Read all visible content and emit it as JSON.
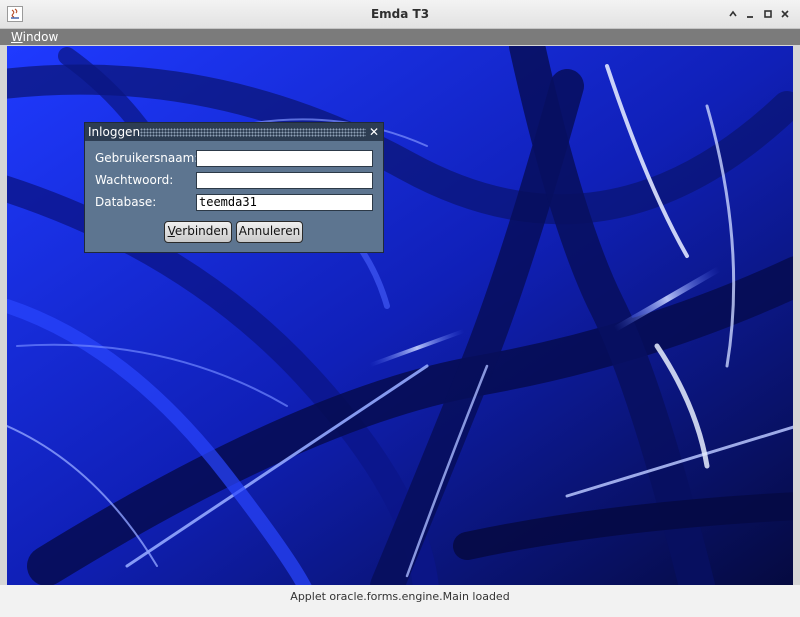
{
  "window": {
    "title": "Emda T3",
    "controls": {
      "minimize": "minimize",
      "maximize": "maximize",
      "close": "close"
    }
  },
  "menubar": {
    "items": [
      {
        "mnemonic": "W",
        "rest": "indow"
      }
    ]
  },
  "dialog": {
    "title": "Inloggen",
    "fields": [
      {
        "label": "Gebruikersnaam:",
        "value": ""
      },
      {
        "label": "Wachtwoord:",
        "value": ""
      },
      {
        "label": "Database:",
        "value": "teemda31"
      }
    ],
    "buttons": {
      "connect": {
        "mnemonic": "V",
        "rest": "erbinden"
      },
      "cancel": {
        "text": "Annuleren"
      }
    }
  },
  "status": {
    "text": "Applet oracle.forms.engine.Main loaded"
  },
  "icons": {
    "app": "java-app-icon",
    "minimize": "minimize-icon",
    "maximize": "maximize-icon",
    "close": "close-icon",
    "restore": "chevron-up-icon"
  },
  "colors": {
    "desktop": "#1a2fe0",
    "dialog_bg": "#5d7590",
    "dialog_titlebar": "#2d3d52",
    "menubar": "#7b7b7b"
  }
}
